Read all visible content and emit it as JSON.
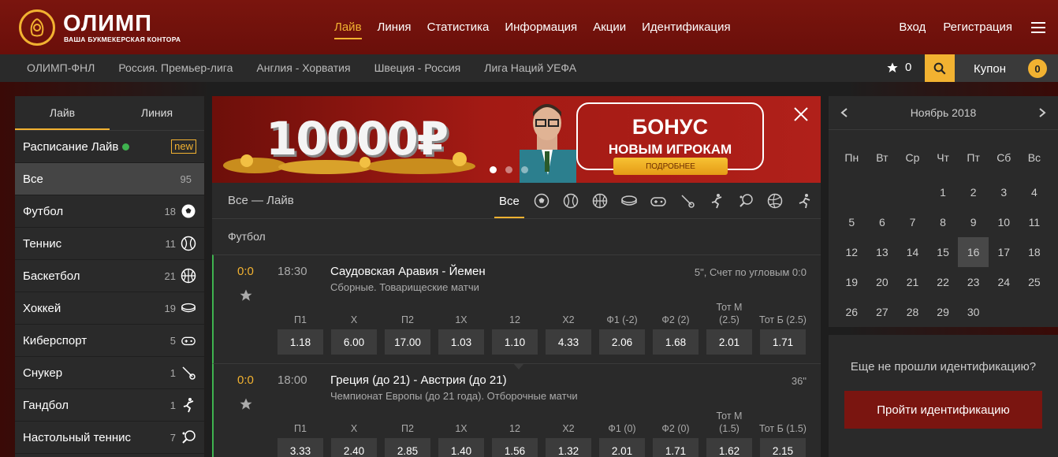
{
  "logo": {
    "name": "ОЛИМП",
    "tagline": "ВАША БУКМЕКЕРСКАЯ КОНТОРА"
  },
  "nav": [
    "Лайв",
    "Линия",
    "Статистика",
    "Информация",
    "Акции",
    "Идентификация"
  ],
  "nav_active": "Лайв",
  "auth": {
    "login": "Вход",
    "register": "Регистрация"
  },
  "subnav": [
    "ОЛИМП-ФНЛ",
    "Россия. Премьер-лига",
    "Англия - Хорватия",
    "Швеция - Россия",
    "Лига Наций УЕФА"
  ],
  "favorites_count": "0",
  "coupon": {
    "label": "Купон",
    "count": "0"
  },
  "sidebar": {
    "tabs": [
      "Лайв",
      "Линия"
    ],
    "schedule": {
      "label": "Расписание Лайв",
      "badge": "new"
    },
    "items": [
      {
        "label": "Все",
        "count": "95",
        "icon": "all"
      },
      {
        "label": "Футбол",
        "count": "18",
        "icon": "football-icon"
      },
      {
        "label": "Теннис",
        "count": "11",
        "icon": "tennis-icon"
      },
      {
        "label": "Баскетбол",
        "count": "21",
        "icon": "basketball-icon"
      },
      {
        "label": "Хоккей",
        "count": "19",
        "icon": "hockey-icon"
      },
      {
        "label": "Киберспорт",
        "count": "5",
        "icon": "gamepad-icon"
      },
      {
        "label": "Снукер",
        "count": "1",
        "icon": "snooker-icon"
      },
      {
        "label": "Гандбол",
        "count": "1",
        "icon": "handball-icon"
      },
      {
        "label": "Настольный теннис",
        "count": "7",
        "icon": "table-tennis-icon"
      }
    ]
  },
  "banner": {
    "amount": "10000₽",
    "title": "БОНУС",
    "subtitle": "НОВЫМ ИГРОКАМ",
    "button": "ПОДРОБНЕЕ"
  },
  "live": {
    "title": "Все — Лайв",
    "filter_all": "Все",
    "section": "Футбол"
  },
  "matches": [
    {
      "score": "0:0",
      "time": "18:30",
      "teams": "Саудовская Аравия - Йемен",
      "league": "Сборные. Товарищеские матчи",
      "status": "5\", Счет по угловым 0:0",
      "odds": [
        {
          "h": "П1",
          "v": "1.18"
        },
        {
          "h": "X",
          "v": "6.00"
        },
        {
          "h": "П2",
          "v": "17.00"
        },
        {
          "h": "1X",
          "v": "1.03"
        },
        {
          "h": "12",
          "v": "1.10"
        },
        {
          "h": "X2",
          "v": "4.33"
        },
        {
          "h": "Ф1 (-2)",
          "v": "2.06"
        },
        {
          "h": "Ф2 (2)",
          "v": "1.68"
        },
        {
          "h": "Тот М (2.5)",
          "v": "2.01"
        },
        {
          "h": "Тот Б (2.5)",
          "v": "1.71"
        }
      ]
    },
    {
      "score": "0:0",
      "time": "18:00",
      "teams": "Греция (до 21) - Австрия (до 21)",
      "league": "Чемпионат Европы (до 21 года). Отборочные матчи",
      "status": "36\"",
      "odds": [
        {
          "h": "П1",
          "v": "3.33"
        },
        {
          "h": "X",
          "v": "2.40"
        },
        {
          "h": "П2",
          "v": "2.85"
        },
        {
          "h": "1X",
          "v": "1.40"
        },
        {
          "h": "12",
          "v": "1.56"
        },
        {
          "h": "X2",
          "v": "1.32"
        },
        {
          "h": "Ф1 (0)",
          "v": "2.01"
        },
        {
          "h": "Ф2 (0)",
          "v": "1.71"
        },
        {
          "h": "Тот М (1.5)",
          "v": "1.62"
        },
        {
          "h": "Тот Б (1.5)",
          "v": "2.15"
        }
      ]
    }
  ],
  "calendar": {
    "month": "Ноябрь 2018",
    "dow": [
      "Пн",
      "Вт",
      "Ср",
      "Чт",
      "Пт",
      "Сб",
      "Вс"
    ],
    "leading_blanks": 3,
    "days": 30,
    "today": 16
  },
  "identification": {
    "question": "Еще не прошли идентификацию?",
    "button": "Пройти идентификацию"
  },
  "colors": {
    "accent": "#f2b231",
    "brand": "#7a150e",
    "live": "#3fb34f"
  }
}
